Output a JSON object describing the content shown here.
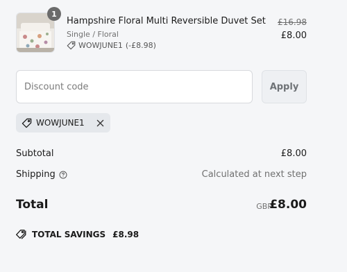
{
  "product": {
    "name": "Hampshire Floral Multi Reversible Duvet Set",
    "variant": "Single / Floral",
    "discount_code": "WOWJUNE1",
    "discount_amount": "(-£8.98)",
    "original_price": "£16.98",
    "price": "£8.00",
    "quantity": "1",
    "icons": {
      "image": "duvet-product-image",
      "discount": "tag-icon"
    }
  },
  "discount_form": {
    "placeholder": "Discount code",
    "value": "",
    "apply_label": "Apply"
  },
  "applied_code": {
    "code": "WOWJUNE1",
    "icons": {
      "tag": "tag-icon",
      "remove": "close-icon"
    }
  },
  "summary": {
    "subtotal_label": "Subtotal",
    "subtotal_value": "£8.00",
    "shipping_label": "Shipping",
    "shipping_value": "Calculated at next step",
    "shipping_info_icon": "help-circle-icon",
    "total_label": "Total",
    "currency": "GBP",
    "total_value": "£8.00"
  },
  "savings": {
    "label": "TOTAL SAVINGS",
    "amount": "£8.98",
    "icon": "tags-icon"
  },
  "colors": {
    "background": "#f5f6f8",
    "text": "#1a1a1a",
    "muted": "#707070",
    "chip_bg": "#e5e8ec",
    "badge_bg": "#6b6b6b"
  }
}
